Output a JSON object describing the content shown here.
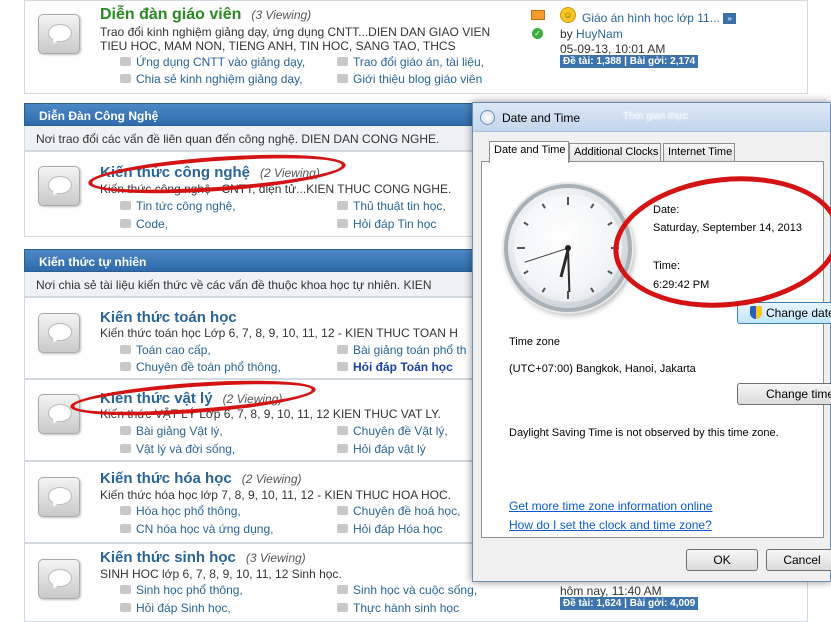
{
  "forum": {
    "row1": {
      "title": "Diễn đàn giáo viên",
      "viewing": "(3 Viewing)",
      "desc_line1": "Trao đổi kinh nghiệm giảng dạy, ứng dụng CNTT...DIEN DAN GIAO VIEN",
      "desc_line2": "TIEU HOC, MAM NON, TIENG ANH, TIN HOC, SANG TAO, THCS",
      "subs": [
        "Ứng dụng CNTT vào giảng dạy,",
        "Trao đổi giáo án, tài liệu,",
        "Chia sẻ kinh nghiệm giảng dạy,",
        "Giới thiệu blog giáo viên"
      ],
      "last_post_title": "Giáo án hình học lớp 11...",
      "last_post_by_prefix": "by",
      "last_post_user": "HuyNam",
      "last_post_time": "05-09-13, 10:01 AM",
      "stats": "Đề tài: 1,388 | Bài gởi: 2,174"
    },
    "cat1": {
      "title": "Diễn Đàn Công Nghệ",
      "desc": "Nơi trao đổi các vấn đề liên quan đến công nghệ. DIEN DAN CONG NGHE.",
      "row": {
        "title": "Kiến thức công nghệ",
        "viewing": "(2 Viewing)",
        "desc": "Kiến thức công nghệ - CNTT, điện tử...KIEN THUC CONG NGHE.",
        "subs": [
          "Tin tức công nghệ,",
          "Thủ thuật tin học,",
          "Code,",
          "Hỏi đáp Tin học"
        ]
      }
    },
    "cat2": {
      "title": "Kiến thức tự nhiên",
      "desc": "Nơi chia sẻ tài liệu kiến thức về các vấn đề thuộc khoa học tự nhiên. KIEN",
      "rows": [
        {
          "title": "Kiến thức toán học",
          "viewing": "",
          "desc": "Kiến thức toán học Lớp 6, 7, 8, 9, 10, 11, 12 - KIEN THUC TOAN H",
          "subs": [
            "Toán cao cấp,",
            "Bài giảng toán phổ th",
            "Chuyên đề toán phổ thông,",
            "Hỏi đáp Toán học"
          ]
        },
        {
          "title": "Kiến thức vật lý",
          "viewing": "(2 Viewing)",
          "desc": "Kiến thức VẬT LÝ Lớp 6, 7, 8, 9, 10, 11, 12 KIEN THUC VAT LY.",
          "subs": [
            "Bài giảng Vật lý,",
            "Chuyên đề Vật lý,",
            "Vật lý và đời sống,",
            "Hỏi đáp vật lý"
          ]
        },
        {
          "title": "Kiến thức hóa học",
          "viewing": "(2 Viewing)",
          "desc": "Kiến thức hóa học lớp 7, 8, 9, 10, 11, 12 - KIEN THUC HOA HOC.",
          "subs": [
            "Hóa học phổ thông,",
            "Chuyên đề hoá học,",
            "CN hóa học và ứng dụng,",
            "Hỏi đáp Hóa học"
          ]
        },
        {
          "title": "Kiến thức sinh học",
          "viewing": "(3 Viewing)",
          "desc": "SINH HOC lớp 6, 7, 8, 9, 10, 11, 12 Sinh học.",
          "subs": [
            "Sinh học phổ thông,",
            "Sinh học và cuộc sống,",
            "Hỏi đáp Sinh học,",
            "Thực hành sinh học"
          ],
          "last_post_time": "hôm nay, 11:40 AM",
          "stats": "Đề tài: 1,624 | Bài gởi: 4,009"
        }
      ]
    }
  },
  "dialog": {
    "title": "Date and Time",
    "ghost_text": "Thời gian thực",
    "tabs": [
      "Date and Time",
      "Additional Clocks",
      "Internet Time"
    ],
    "date_label": "Date:",
    "date_value": "Saturday, September 14, 2013",
    "time_label": "Time:",
    "time_value": "6:29:42 PM",
    "change_date_button": "Change date",
    "timezone_label": "Time zone",
    "timezone_value": "(UTC+07:00) Bangkok, Hanoi, Jakarta",
    "change_timezone_button": "Change time",
    "dst_text": "Daylight Saving Time is not observed by this time zone.",
    "link1": "Get more time zone information online",
    "link2": "How do I set the clock and time zone?",
    "ok_button": "OK",
    "cancel_button": "Cancel",
    "clock_time": {
      "hour": 6,
      "minute": 29,
      "second": 42
    }
  },
  "colors": {
    "annotation_red": "#d41414",
    "category_header": "#3670ae",
    "link_blue": "#2a6496"
  }
}
